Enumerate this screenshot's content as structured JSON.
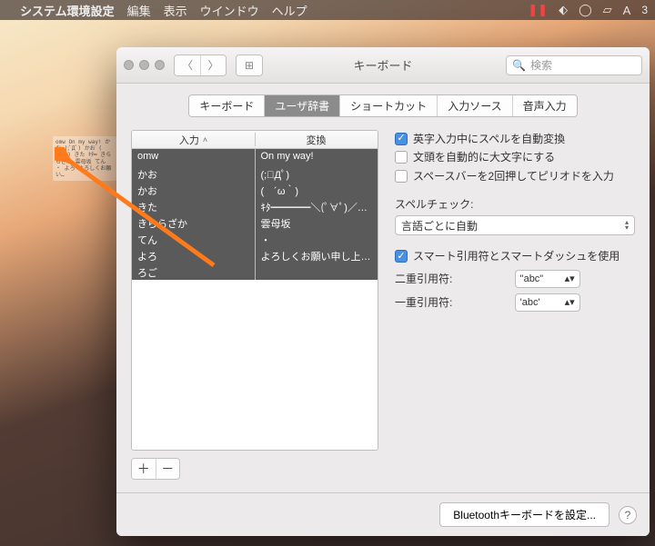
{
  "menubar": {
    "app": "システム環境設定",
    "items": [
      "編集",
      "表示",
      "ウインドウ",
      "ヘルプ"
    ],
    "badge": "3"
  },
  "window": {
    "title": "キーボード",
    "search_placeholder": "検索",
    "tabs": [
      "キーボード",
      "ユーザ辞書",
      "ショートカット",
      "入力ソース",
      "音声入力"
    ],
    "active_tab": 1,
    "headers": {
      "input": "入力",
      "output": "変換"
    },
    "rows": [
      {
        "in": "omw",
        "out": "On my way!"
      },
      {
        "in": "かお",
        "out": "(;ﾟДﾟ)"
      },
      {
        "in": "かお",
        "out": "(　´ω｀)"
      },
      {
        "in": "きた",
        "out": "ｷﾀ━━━━＼(ﾟ∀ﾟ)／━…"
      },
      {
        "in": "きららざか",
        "out": "雲母坂"
      },
      {
        "in": "てん",
        "out": "・"
      },
      {
        "in": "よろ",
        "out": "よろしくお願い申し上げま…"
      },
      {
        "in": "ろご",
        "out": ""
      }
    ],
    "options": {
      "autospell": "英字入力中にスペルを自動変換",
      "capitalize": "文頭を自動的に大文字にする",
      "double_space": "スペースバーを2回押してピリオドを入力",
      "spellcheck_label": "スペルチェック:",
      "spellcheck_value": "言語ごとに自動",
      "smart_quotes": "スマート引用符とスマートダッシュを使用",
      "double_q_label": "二重引用符:",
      "double_q_value": "\"abc\"",
      "single_q_label": "一重引用符:",
      "single_q_value": "'abc'"
    },
    "bt_button": "Bluetoothキーボードを設定..."
  },
  "dragged_preview": "omw  On my way!\nかお  (;ﾟДﾟ)\nかお  (　´ω｀)\nきた  ｷﾀ━\nきららざか 雲母坂\nてん  ・\nよろ よろしくお願い…"
}
